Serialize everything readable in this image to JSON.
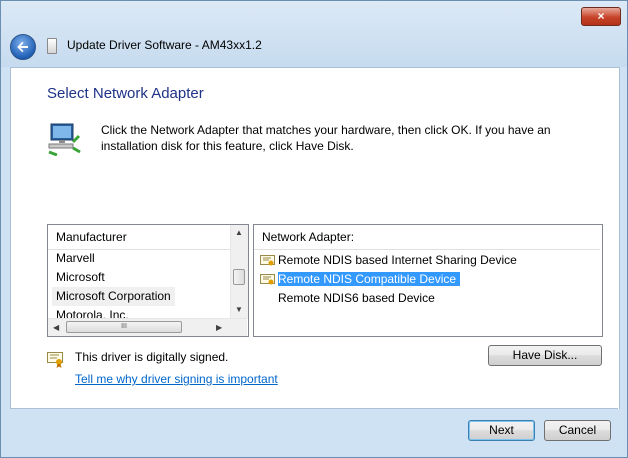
{
  "window": {
    "title": "Update Driver Software - AM43xx1.2",
    "close_glyph": "×"
  },
  "page": {
    "heading": "Select Network Adapter",
    "description": "Click the Network Adapter that matches your hardware, then click OK. If you have an installation disk for this feature, click Have Disk."
  },
  "manufacturer_list": {
    "header": "Manufacturer",
    "items": [
      "Marvell",
      "Microsoft",
      "Microsoft Corporation",
      "Motorola, Inc."
    ],
    "selected": "Microsoft Corporation",
    "hscroll_grip": "III"
  },
  "adapter_list": {
    "header": "Network Adapter:",
    "items": [
      {
        "label": "Remote NDIS based Internet Sharing Device",
        "icon": "certificate-icon",
        "selected": false
      },
      {
        "label": "Remote NDIS Compatible Device",
        "icon": "certificate-icon",
        "selected": true
      },
      {
        "label": "Remote NDIS6 based Device",
        "icon": "",
        "selected": false
      }
    ]
  },
  "signing": {
    "status": "This driver is digitally signed.",
    "link": "Tell me why driver signing is important"
  },
  "buttons": {
    "have_disk": "Have Disk...",
    "next": "Next",
    "cancel": "Cancel"
  },
  "colors": {
    "heading": "#1e3287",
    "selection": "#3399ff",
    "link": "#0066cc",
    "close_button": "#c7432a"
  }
}
